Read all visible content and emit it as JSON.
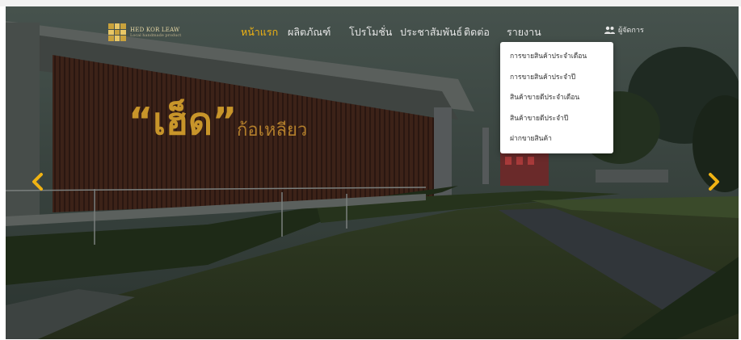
{
  "logo": {
    "name": "HED KOR LEAW",
    "tagline": "Local handmade product"
  },
  "nav": {
    "items": [
      {
        "label": "หน้าแรก",
        "active": true
      },
      {
        "label": "ผลิตภัณฑ์",
        "active": false
      },
      {
        "label": "โปรโมชั่น",
        "active": false
      },
      {
        "label": "ประชาสัมพันธ์",
        "active": false
      },
      {
        "label": "ติดต่อ",
        "active": false
      },
      {
        "label": "รายงาน",
        "active": false
      }
    ],
    "admin_label": "ผู้จัดการ",
    "active_color": "#f0b313"
  },
  "report_menu": {
    "items": [
      "การขายสินค้าประจำเดือน",
      "การขายสินค้าประจำปี",
      "สินค้าขายดีประจำเดือน",
      "สินค้าขายดีประจำปี",
      "ฝากขายสินค้า"
    ]
  },
  "hero": {
    "sign_quote_text": "“เฮ็ด”",
    "sign_sub_text": "ก้อเหลียว",
    "sign_color": "#c8952a"
  },
  "icons": {
    "prev": "chevron-left-icon",
    "next": "chevron-right-icon",
    "admin": "users-icon"
  }
}
